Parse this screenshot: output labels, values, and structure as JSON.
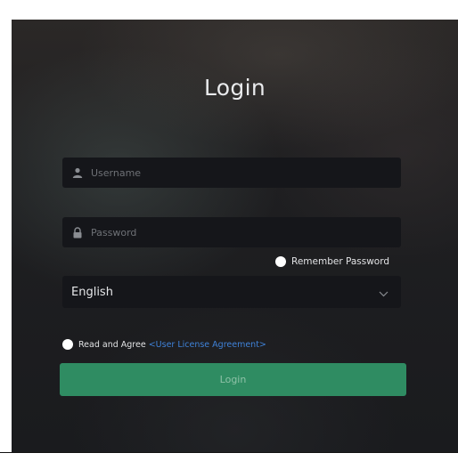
{
  "login": {
    "title": "Login",
    "username": {
      "placeholder": "Username",
      "value": ""
    },
    "password": {
      "placeholder": "Password",
      "value": ""
    },
    "remember_label": "Remember Password",
    "language": {
      "selected": "English"
    },
    "agree": {
      "text": "Read and Agree",
      "link": "<User License Agreement>"
    },
    "button_label": "Login"
  },
  "icons": {
    "username": "user-icon",
    "password": "lock-icon",
    "language": "chevron-down-icon"
  },
  "colors": {
    "accent": "#2f8c62",
    "link": "#3f82d8",
    "field_bg": "#15161a"
  }
}
